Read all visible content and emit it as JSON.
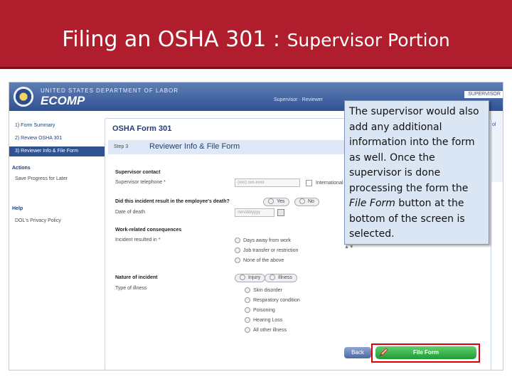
{
  "slide": {
    "title_main": "Filing an OSHA 301 : ",
    "title_sub": "Supervisor Portion"
  },
  "app": {
    "department": "UNITED STATES DEPARTMENT OF LABOR",
    "brand": "ECOMP",
    "top_nav": "Supervisor  ·  Reviewer",
    "top_right_tag": "SUPERVISOR",
    "right_strip_label": "ol"
  },
  "sidebar": {
    "items": [
      {
        "label": "1) Form Summary"
      },
      {
        "label": "2) Review OSHA 301"
      },
      {
        "label": "3) Reviewer Info & File Form"
      }
    ],
    "actions_heading": "Actions",
    "actions_link": "Save Progress for Later",
    "help_heading": "Help",
    "help_link": "DOL's Privacy Policy"
  },
  "form": {
    "title": "OSHA Form 301",
    "step_label": "Step 3",
    "step_title": "Reviewer Info & File Form",
    "supervisor_contact_heading": "Supervisor contact",
    "phone_label": "Supervisor telephone *",
    "phone_placeholder": "(xxx) xxx-xxxx",
    "international_label": "International",
    "death_question": "Did this incident result in the employee's death?",
    "death_yes": "Yes",
    "death_no": "No",
    "date_label": "Date of death",
    "date_placeholder": "mm/dd/yyyy",
    "work_related_heading": "Work-related consequences",
    "incident_resulted_label": "Incident resulted in *",
    "consequences": [
      "Days away from work",
      "Job transfer or restriction",
      "None of the above"
    ],
    "nature_heading": "Nature of incident",
    "nature_options": [
      "Injury",
      "Illness"
    ],
    "type_label": "Type of illness",
    "illness_types": [
      "Skin disorder",
      "Respiratory condition",
      "Poisoning",
      "Hearing Loss",
      "All other illness"
    ],
    "back_label": "Back",
    "file_label": "File Form"
  },
  "callout": {
    "text_before": "The supervisor would also add any additional information into the form as well.  Once the supervisor is done processing the form the ",
    "emphasis": "File Form",
    "text_after": " button at the bottom of the screen is selected."
  },
  "colors": {
    "slide_header": "#b01e2e",
    "app_blue": "#2f5293",
    "file_button": "#1f9a34",
    "highlight": "#e00000",
    "callout_bg": "#dbe6f4"
  }
}
